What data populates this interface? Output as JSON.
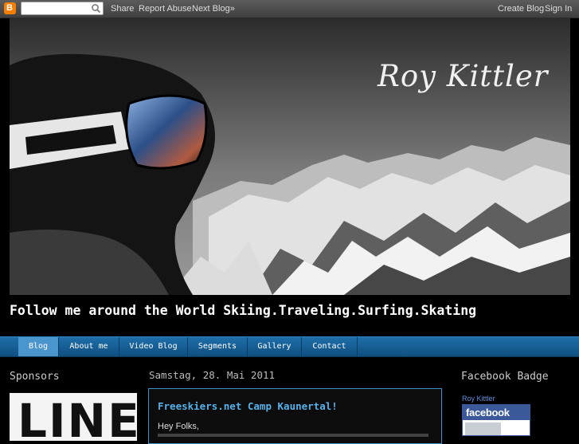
{
  "navbar": {
    "logo_letter": "B",
    "search_placeholder": "",
    "share": "Share",
    "report_abuse": "Report Abuse",
    "next_blog": "Next Blog»",
    "create_blog": "Create Blog",
    "sign_in": "Sign In"
  },
  "header": {
    "title": "Roy Kittler",
    "tagline": "Follow me around the World Skiing.Traveling.Surfing.Skating"
  },
  "tabs": [
    {
      "label": "Blog",
      "selected": true
    },
    {
      "label": "About me"
    },
    {
      "label": "Video Blog"
    },
    {
      "label": "Segments"
    },
    {
      "label": "Gallery"
    },
    {
      "label": "Contact"
    }
  ],
  "sidebar_left": {
    "title": "Sponsors",
    "sponsor_logo_text": "LINE"
  },
  "main": {
    "date": "Samstag, 28. Mai 2011",
    "post_title": "Freeskiers.net Camp Kaunertal!",
    "post_greeting": "Hey Folks,"
  },
  "sidebar_right": {
    "title": "Facebook Badge",
    "author": "Roy Kittler",
    "fb_logo": "facebook"
  },
  "colors": {
    "accent_blue": "#1f6eaa",
    "post_title": "#58b0e8",
    "facebook_blue": "#3b5998",
    "blogger_orange": "#f57d00"
  }
}
